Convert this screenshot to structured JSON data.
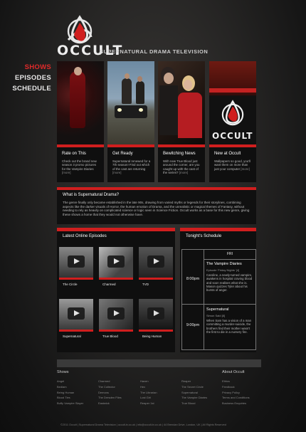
{
  "header": {
    "brand": "OCCULT",
    "tagline": "SUPERNATURAL DRAMA TELEVISION"
  },
  "nav": {
    "items": [
      {
        "label": "SHOWS"
      },
      {
        "label": "EPISODES"
      },
      {
        "label": "SCHEDULE"
      }
    ]
  },
  "features": [
    {
      "title": "Rate on This",
      "text": "Check out the brand new season 3 promo pictures for the Vampire Diaries",
      "more": "[more]"
    },
    {
      "title": "Get Ready",
      "text": "Supernatural renewed for a 7th season! Find out which of the cast are returning",
      "more": "[more]"
    },
    {
      "title": "Bewitching News",
      "text": "With new True Blood just around the corner, are you caught up with the cast of the series?",
      "more": "[more]"
    },
    {
      "title": "New at Occult",
      "text": "Wallpapers so good, you'll want them on more than just your computer",
      "more": "[more]"
    }
  ],
  "about": {
    "heading": "What is Supernatural Drama?",
    "text": "The genre finally only became established in the late 90s, drawing from varied myths or legends for their storylines, combining aspects like the darker visuals of Horror, the human emotion of Drama, and the unrealistic or magical themes of Fantasy, without needing to rely as heavily on complicated science or logic seen in Science Fiction. Occult works as a base for this new genre, giving these shows a home that they would not otherwise have."
  },
  "episodes": {
    "heading": "Latest Online Episodes",
    "items": [
      {
        "label": "The Circle"
      },
      {
        "label": "Charmed"
      },
      {
        "label": "TVD"
      },
      {
        "label": "Supernatural"
      },
      {
        "label": "True Blood"
      },
      {
        "label": "Being Human"
      }
    ]
  },
  "schedule": {
    "heading": "Tonight's Schedule",
    "day": "FRI",
    "rows": [
      {
        "time": "8:00pm",
        "title": "The Vampire Diaries",
        "subtitle": "Episode 'Friday Nights' [4]",
        "text": "Caroline, a newly-turned vampire, awakens in hospital craving blood and soon realises what she is. Mason quizzes Tyler about his bursts of anger."
      },
      {
        "time": "9:00pm",
        "title": "Supernatural",
        "subtitle": "Simon Said [8]",
        "text": "When Sam has a vision of a man committing a murder-suicide, the brothers find their mother wasn't the first to die in a nursery fire."
      }
    ]
  },
  "footer": {
    "shows_heading": "Shows",
    "about_heading": "About Occult",
    "columns": [
      [
        "Angel",
        "Bedlam",
        "Being Human",
        "Blood Ties",
        "Buffy Vampire Slayer"
      ],
      [
        "Charmed",
        "The Collector",
        "Demons",
        "The Dresden Files",
        "Eastwick"
      ],
      [
        "Haven",
        "Hex",
        "The Librarian",
        "Lost Girl",
        "Reaper 1st"
      ],
      [
        "Reaper",
        "The Secret Circle",
        "Supernatural",
        "The Vampire Diaries",
        "True Blood"
      ],
      [
        "Ethics",
        "Feedback",
        "Privacy Policy",
        "Terms and Conditions",
        "Business Enquiries"
      ]
    ],
    "copyright": "©2011 Occult | Supernatural Drama Television | occult-tv.co.uk | info@occult-tv.co.uk | 44 Brendan Drive, London, UK | All Rights Reserved"
  },
  "colors": {
    "accent": "#d01e1e",
    "background": "#1b1b1b"
  }
}
